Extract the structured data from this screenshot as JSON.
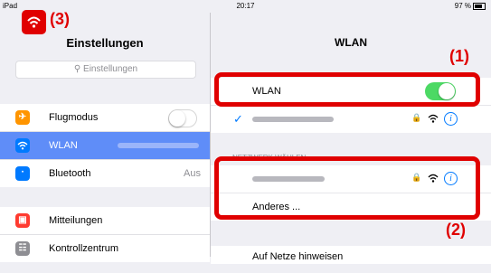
{
  "status": {
    "device": "iPad",
    "time": "20:17",
    "battery": "97 %"
  },
  "sidebar": {
    "title": "Einstellungen",
    "search_placeholder": "Einstellungen",
    "items": [
      {
        "label": "Flugmodus",
        "icon": "airplane-icon",
        "color": "#ff9500",
        "toggle": "off"
      },
      {
        "label": "WLAN",
        "icon": "wifi-icon",
        "color": "#007aff",
        "active": true
      },
      {
        "label": "Bluetooth",
        "icon": "bluetooth-icon",
        "color": "#007aff",
        "value": "Aus"
      },
      {
        "label": "Mitteilungen",
        "icon": "notifications-icon",
        "color": "#ff3b30"
      },
      {
        "label": "Kontrollzentrum",
        "icon": "control-center-icon",
        "color": "#8e8e93"
      }
    ]
  },
  "main": {
    "title": "WLAN",
    "wlan_label": "WLAN",
    "wlan_toggle": "on",
    "section_header": "NETZWERK WÄHLEN ...",
    "other_label": "Anderes ...",
    "ask_label": "Auf Netze hinweisen"
  },
  "annotations": {
    "label_1": "(1)",
    "label_2": "(2)",
    "label_3": "(3)"
  },
  "colors": {
    "accent": "#007aff",
    "toggle_on": "#4cd964",
    "highlight": "#e00000",
    "selection": "#5f8df8"
  }
}
